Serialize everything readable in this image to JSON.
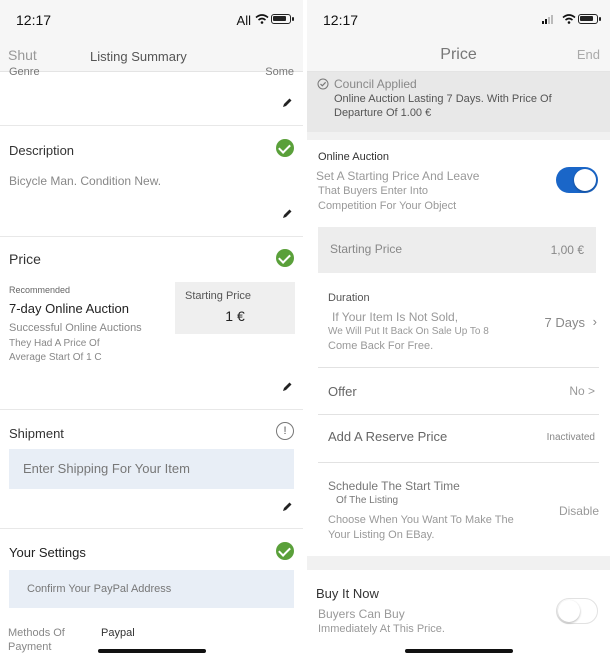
{
  "left": {
    "status": {
      "time": "12:17",
      "carrier": "All"
    },
    "nav": {
      "left": "Shut",
      "title": "Listing Summary"
    },
    "genre_row": {
      "label": "Genre",
      "value": "Some"
    },
    "description": {
      "title": "Description",
      "text": "Bicycle Man. Condition New."
    },
    "price": {
      "title": "Price",
      "recommended": "Recommended",
      "auction_title": "7-day Online Auction",
      "auction_desc_1": "Successful Online Auctions",
      "auction_desc_2": "They Had A Price Of",
      "auction_desc_3": "Average Start Of 1 C",
      "starting_label": "Starting Price",
      "starting_value": "1 €"
    },
    "shipment": {
      "title": "Shipment",
      "placeholder": "Enter Shipping For Your Item"
    },
    "settings": {
      "title": "Your Settings",
      "paypal": "Confirm Your PayPal Address"
    },
    "payment": {
      "label_1": "Methods Of",
      "label_2": "Payment",
      "value": "Paypal"
    }
  },
  "right": {
    "status": {
      "time": "12:17"
    },
    "nav": {
      "title": "Price",
      "right": "End"
    },
    "banner": {
      "title": "Council Applied",
      "text_1": "Online Auction Lasting 7 Days. With Price Of",
      "text_2": "Departure Of 1.00 €"
    },
    "online_auction": {
      "title": "Online Auction",
      "desc_1": "Set A Starting Price And Leave",
      "desc_2": "That Buyers Enter Into",
      "desc_3": "Competition For Your Object",
      "enabled": true
    },
    "starting_price": {
      "label": "Starting Price",
      "value": "1,00 €"
    },
    "duration": {
      "label": "Duration",
      "desc_1": "If Your Item Is Not Sold,",
      "desc_2": "We Will Put It Back On Sale Up To 8",
      "desc_3": "Come Back For Free.",
      "value": "7 Days"
    },
    "offer": {
      "label": "Offer",
      "value": "No >"
    },
    "reserve": {
      "label": "Add A Reserve Price",
      "value": "Inactivated"
    },
    "schedule": {
      "label_1": "Schedule The Start Time",
      "label_2": "Of The Listing",
      "desc_1": "Choose When You Want To Make The",
      "desc_2": "Your Listing On EBay.",
      "value": "Disable"
    },
    "buy_now": {
      "title": "Buy It Now",
      "desc_1": "Buyers Can Buy",
      "desc_2": "Immediately At This Price.",
      "enabled": false
    }
  },
  "colors": {
    "accent_blue": "#1a66c8",
    "check_green": "#5aa03a",
    "field_blue": "#e8eef6"
  }
}
